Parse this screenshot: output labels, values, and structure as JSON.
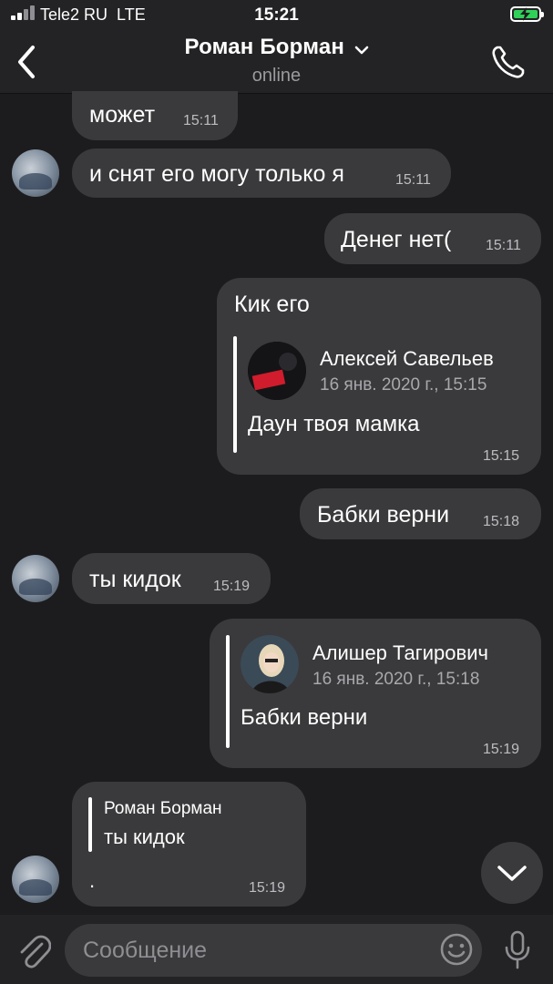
{
  "status_bar": {
    "carrier": "Tele2 RU",
    "network": "LTE",
    "time": "15:21",
    "battery_color": "#2fd158"
  },
  "header": {
    "title": "Роман Борман",
    "subtitle": "online",
    "back_icon": "chevron-left-icon",
    "call_icon": "phone-icon",
    "title_icon": "chevron-down-icon"
  },
  "messages": [
    {
      "direction": "in",
      "text": "может",
      "time": "15:11"
    },
    {
      "direction": "in",
      "text": "и снят его могу только я",
      "time": "15:11"
    },
    {
      "direction": "out",
      "text": "Денег нет(",
      "time": "15:11"
    },
    {
      "direction": "out",
      "text": "Кик его",
      "time": "15:15",
      "forwarded": {
        "name": "Алексей Савельев",
        "date": "16 янв. 2020 г., 15:15",
        "text": "Даун твоя мамка"
      }
    },
    {
      "direction": "out",
      "text": "Бабки верни",
      "time": "15:18"
    },
    {
      "direction": "in",
      "text": "ты кидок",
      "time": "15:19"
    },
    {
      "direction": "out",
      "text": "",
      "time": "15:19",
      "forwarded": {
        "name": "Алишер Тагирович",
        "date": "16 янв. 2020 г., 15:18",
        "text": "Бабки верни"
      }
    },
    {
      "direction": "in",
      "text": ".",
      "time": "15:19",
      "reply": {
        "name": "Роман Борман",
        "text": "ты кидок"
      }
    }
  ],
  "composer": {
    "placeholder": "Сообщение",
    "attach_icon": "paperclip-icon",
    "emoji_icon": "smiley-icon",
    "mic_icon": "microphone-icon"
  },
  "scroll_down_icon": "chevron-down-icon",
  "colors": {
    "background": "#1c1c1e",
    "bubble": "#3a3a3c",
    "header": "#232325"
  }
}
